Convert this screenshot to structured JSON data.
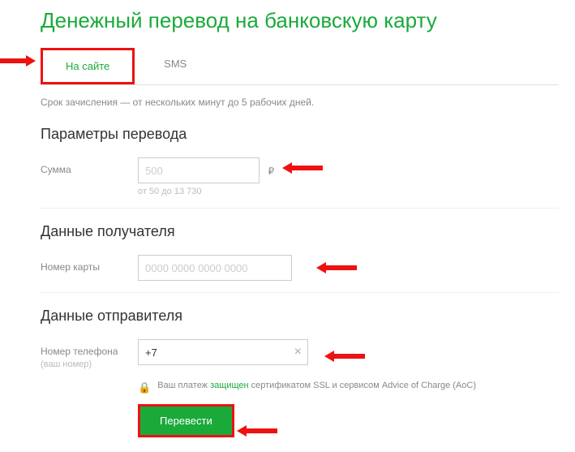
{
  "title": "Денежный перевод на банковскую карту",
  "tabs": {
    "site": "На сайте",
    "sms": "SMS"
  },
  "note": "Срок зачисления — от нескольких минут до 5 рабочих дней.",
  "sections": {
    "params": "Параметры перевода",
    "recipient": "Данные получателя",
    "sender": "Данные отправителя"
  },
  "amount": {
    "label": "Сумма",
    "placeholder": "500",
    "currency": "₽",
    "hint": "от 50 до 13 730"
  },
  "card": {
    "label": "Номер карты",
    "placeholder": "0000 0000 0000 0000"
  },
  "phone": {
    "label": "Номер телефона",
    "sublabel": "(ваш номер)",
    "value": "+7"
  },
  "security": {
    "prefix": "Ваш платеж ",
    "green": "защищен",
    "rest": " сертификатом SSL и сервисом Advice of Charge (AoC)"
  },
  "submit": "Перевести"
}
